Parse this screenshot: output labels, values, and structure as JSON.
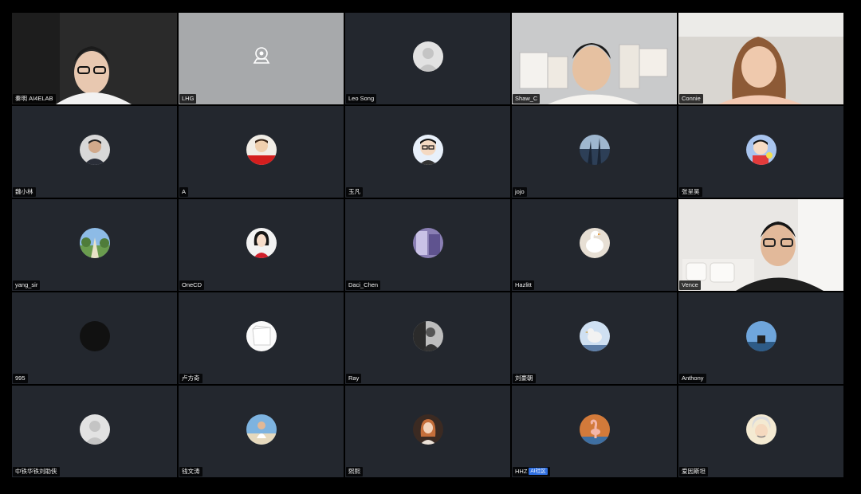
{
  "participants": [
    {
      "name": "秦明 AI4ELAB"
    },
    {
      "name": "LHG"
    },
    {
      "name": "Leo Song"
    },
    {
      "name": "Shaw_C"
    },
    {
      "name": "Connie"
    },
    {
      "name": "魏小林"
    },
    {
      "name": "A"
    },
    {
      "name": "玉凡"
    },
    {
      "name": "jojo"
    },
    {
      "name": "张呈昊"
    },
    {
      "name": "yang_sir"
    },
    {
      "name": "OneCD"
    },
    {
      "name": "Daci_Chen"
    },
    {
      "name": "Hazlitt"
    },
    {
      "name": "Vence"
    },
    {
      "name": "995"
    },
    {
      "name": "卢方奇"
    },
    {
      "name": "Ray"
    },
    {
      "name": "刘豪朝"
    },
    {
      "name": "Anthony"
    },
    {
      "name": "中铁华铁刘助侠"
    },
    {
      "name": "钱文涛"
    },
    {
      "name": "熙熙"
    },
    {
      "name": "HHZ",
      "badge": "AI社区"
    },
    {
      "name": "爱因斯坦"
    }
  ],
  "colors": {
    "tile_bg": "#23272e",
    "speaking_border": "#5fc25d",
    "badge_bg": "#2f6fe0"
  },
  "icons": {
    "camera_off": "camera-icon",
    "default_avatar": "person-silhouette-icon"
  }
}
